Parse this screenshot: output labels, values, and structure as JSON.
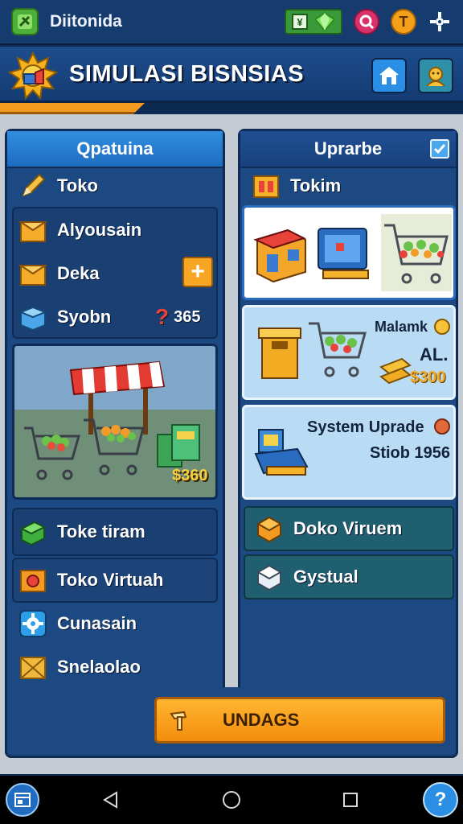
{
  "status_bar": {
    "app_name": "Diitonida",
    "coin_label": "T"
  },
  "header": {
    "title": "SIMULASI BISNSIAS"
  },
  "left_panel": {
    "title": "Qpatuina",
    "header_item": "Toko",
    "items": [
      {
        "label": "Alyousain",
        "icon": "box-icon"
      },
      {
        "label": "Deka",
        "icon": "box-icon",
        "action": "+"
      },
      {
        "label": "Syobn",
        "icon": "blue-crate-icon",
        "value": "365"
      }
    ],
    "scene_price": "$360",
    "list": [
      {
        "label": "Toke tiram",
        "icon": "green-cube-icon"
      },
      {
        "label": "Toko Virtuah",
        "icon": "orange-crate-icon"
      },
      {
        "label": "Cunasain",
        "icon": "gear-icon"
      },
      {
        "label": "Snelaolao",
        "icon": "wood-crate-icon"
      }
    ]
  },
  "right_panel": {
    "title": "Uprarbe",
    "header_item": "Tokim",
    "card_market": {
      "label": "Malamk",
      "price_top": "AL.",
      "price": "$300"
    },
    "card_system": {
      "title": "System Uprade",
      "subtitle": "Stiob 1956"
    },
    "list": [
      {
        "label": "Doko Viruem",
        "icon": "orange-cube-icon"
      },
      {
        "label": "Gystual",
        "icon": "white-cube-icon"
      }
    ]
  },
  "upgrade_button": {
    "label": "UNDAGS"
  },
  "colors": {
    "accent_orange": "#f7a21f",
    "panel_blue": "#1d4982",
    "header_blue": "#2f8ee0"
  }
}
